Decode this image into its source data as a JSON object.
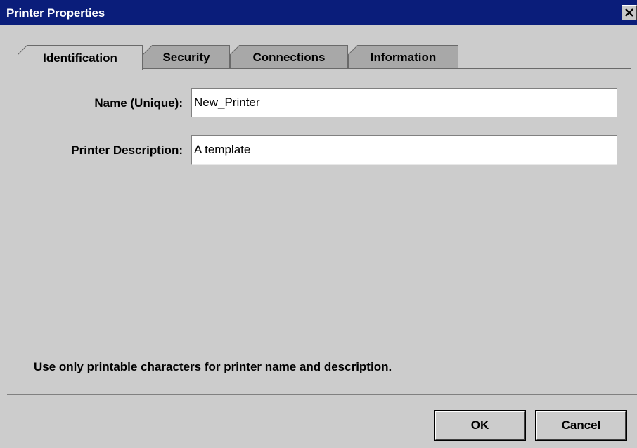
{
  "window": {
    "title": "Printer Properties",
    "close_icon": "close-icon"
  },
  "tabs": [
    {
      "label": "Identification",
      "active": true
    },
    {
      "label": "Security",
      "active": false
    },
    {
      "label": "Connections",
      "active": false
    },
    {
      "label": "Information",
      "active": false
    }
  ],
  "form": {
    "name_label": "Name (Unique):",
    "name_value": "New_Printer",
    "description_label": "Printer Description:",
    "description_value": "A template"
  },
  "note": "Use only printable characters for printer name and description.",
  "buttons": {
    "ok_mnemonic": "O",
    "ok_rest": "K",
    "cancel_mnemonic": "C",
    "cancel_rest": "ancel"
  },
  "colors": {
    "titlebar": "#0a1d7a",
    "background": "#cccccc",
    "inactive_tab": "#a8a8a8"
  }
}
